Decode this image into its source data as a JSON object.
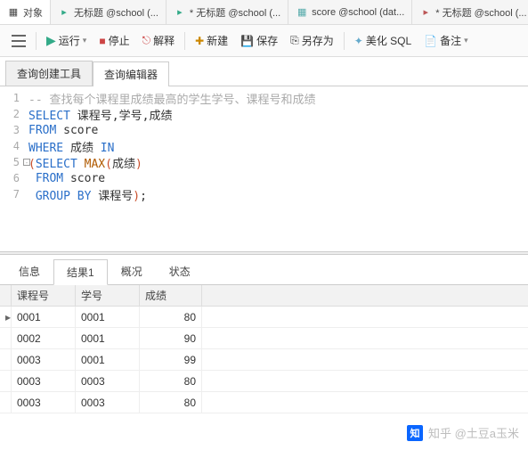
{
  "top_tabs": {
    "t0": "对象",
    "t1": "无标题 @school (...",
    "t2": "* 无标题 @school (...",
    "t3": "score @school (dat...",
    "t4": "* 无标题 @school (..."
  },
  "toolbar": {
    "run": "运行",
    "stop": "停止",
    "explain": "解释",
    "new": "新建",
    "save": "保存",
    "saveas": "另存为",
    "beautify": "美化 SQL",
    "note": "备注"
  },
  "subtabs": {
    "builder": "查询创建工具",
    "editor": "查询编辑器"
  },
  "code": {
    "l1_comment": "-- 查找每个课程里成绩最高的学生学号、课程号和成绩",
    "l2_kw": "SELECT",
    "l2_rest": " 课程号,学号,成绩",
    "l3_kw": "FROM",
    "l3_rest": " score",
    "l4_kw": "WHERE",
    "l4_rest": " 成绩 ",
    "l4_in": "IN",
    "l5_p1": "(",
    "l5_kw": "SELECT",
    "l5_sp": " ",
    "l5_fn": "MAX",
    "l5_p2": "(",
    "l5_arg": "成绩",
    "l5_p3": ")",
    "l6_kw": "FROM",
    "l6_rest": " score",
    "l7_kw": "GROUP BY",
    "l7_rest": " 课程号",
    "l7_p": ")",
    "l7_end": ";"
  },
  "result_tabs": {
    "info": "信息",
    "res1": "结果1",
    "profile": "概况",
    "status": "状态"
  },
  "grid": {
    "h1": "课程号",
    "h2": "学号",
    "h3": "成绩",
    "rows": [
      {
        "c1": "0001",
        "c2": "0001",
        "c3": "80"
      },
      {
        "c1": "0002",
        "c2": "0001",
        "c3": "90"
      },
      {
        "c1": "0003",
        "c2": "0001",
        "c3": "99"
      },
      {
        "c1": "0003",
        "c2": "0003",
        "c3": "80"
      },
      {
        "c1": "0003",
        "c2": "0003",
        "c3": "80"
      }
    ]
  },
  "watermark": "知乎 @土豆a玉米"
}
